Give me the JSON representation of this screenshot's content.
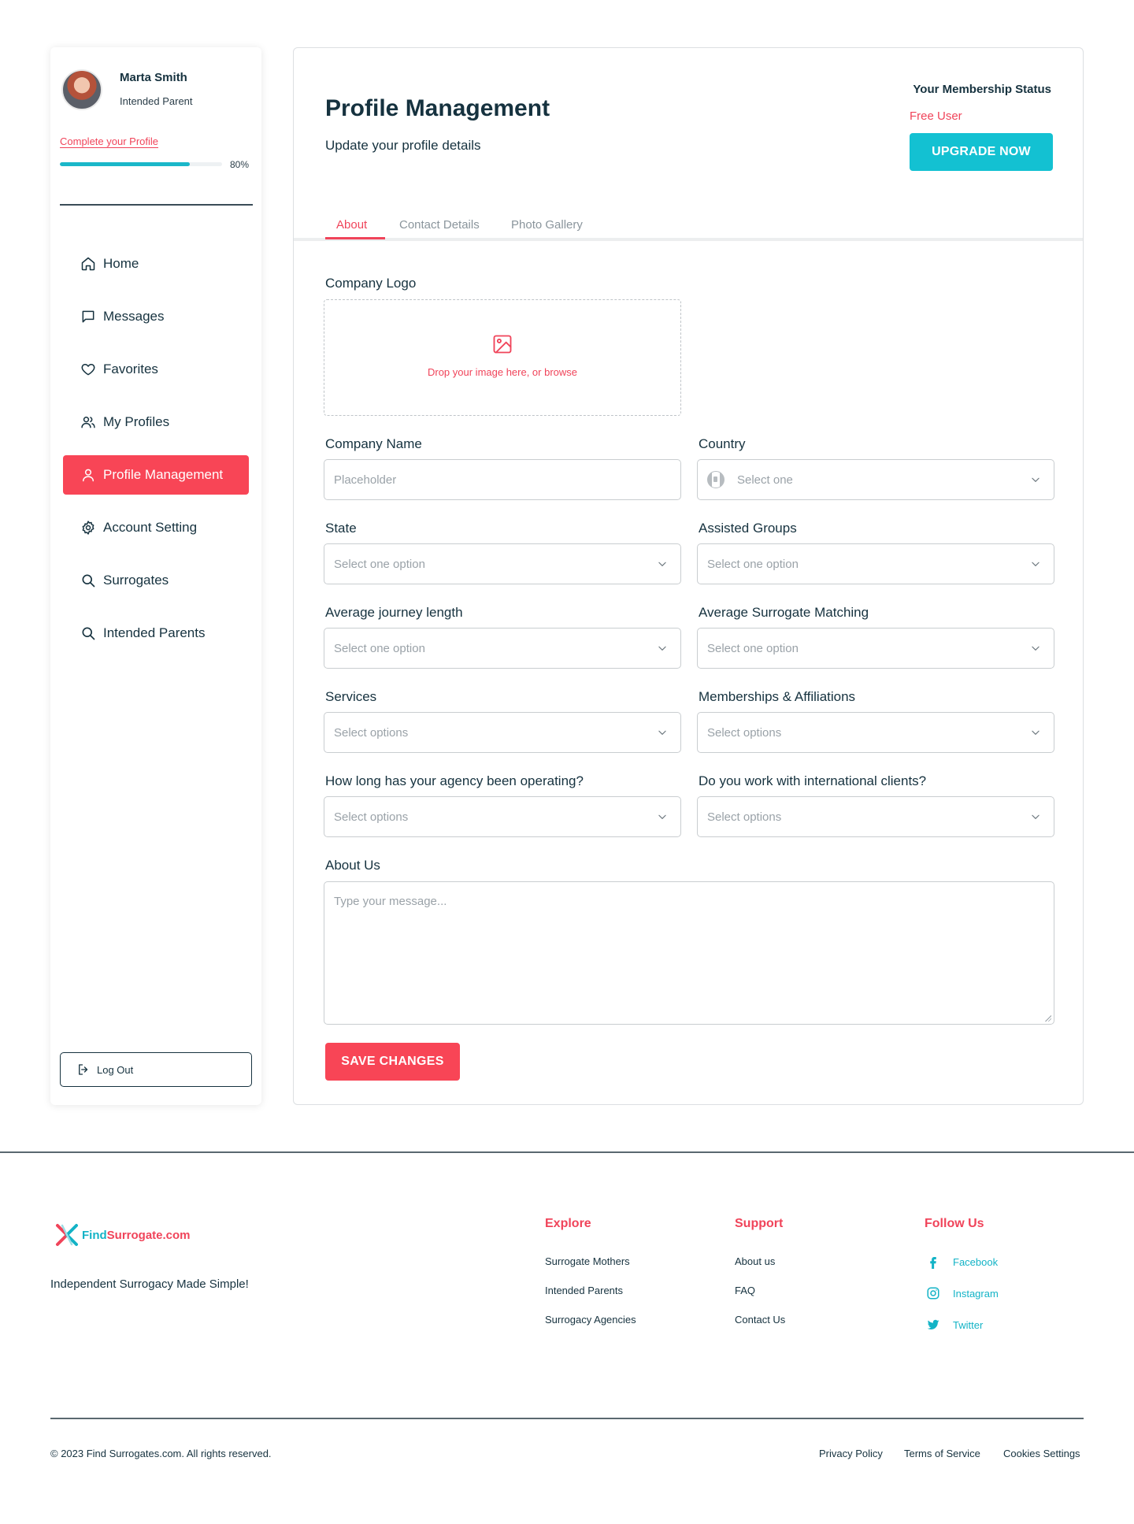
{
  "sidebar": {
    "user_name": "Marta Smith",
    "user_role": "Intended Parent",
    "complete_profile_link": "Complete your Profile",
    "profile_progress": 80,
    "profile_progress_label": "80%",
    "nav": [
      {
        "label": "Home",
        "icon": "home-icon"
      },
      {
        "label": "Messages",
        "icon": "message-icon"
      },
      {
        "label": "Favorites",
        "icon": "heart-icon"
      },
      {
        "label": "My Profiles",
        "icon": "users-icon"
      },
      {
        "label": "Profile Management",
        "icon": "user-icon",
        "active": true
      },
      {
        "label": "Account Setting",
        "icon": "gear-icon"
      },
      {
        "label": "Surrogates",
        "icon": "search-icon"
      },
      {
        "label": "Intended Parents",
        "icon": "search-icon"
      }
    ],
    "logout_label": "Log Out"
  },
  "header": {
    "title": "Profile Management",
    "subtitle": "Update your profile details",
    "membership_label": "Your Membership Status",
    "membership_value": "Free User",
    "upgrade_label": "UPGRADE NOW"
  },
  "tabs": [
    {
      "label": "About",
      "active": true
    },
    {
      "label": "Contact Details",
      "active": false
    },
    {
      "label": "Photo Gallery",
      "active": false
    }
  ],
  "form": {
    "logo_label": "Company Logo",
    "dropzone_text": "Drop your image here, or browse",
    "company_name_label": "Company Name",
    "company_name_placeholder": "Placeholder",
    "country_label": "Country",
    "country_value": "Select one",
    "state_label": "State",
    "state_value": "Select one option",
    "assisted_groups_label": "Assisted Groups",
    "assisted_groups_value": "Select one option",
    "journey_label": "Average journey length",
    "journey_value": "Select one option",
    "matching_label": "Average Surrogate Matching",
    "matching_value": "Select one option",
    "services_label": "Services",
    "services_value": "Select options",
    "memberships_label": "Memberships & Affiliations",
    "memberships_value": "Select options",
    "operating_label": "How long has your agency been operating?",
    "operating_value": "Select options",
    "international_label": "Do you work with international clients?",
    "international_value": "Select options",
    "about_label": "About Us",
    "about_placeholder": "Type your message...",
    "save_label": "SAVE CHANGES"
  },
  "footer": {
    "logo_find": "Find",
    "logo_rest": "Surrogate.com",
    "tagline": "Independent Surrogacy Made Simple!",
    "explore_title": "Explore",
    "explore_links": [
      "Surrogate Mothers",
      "Intended Parents",
      "Surrogacy Agencies"
    ],
    "support_title": "Support",
    "support_links": [
      "About us",
      "FAQ",
      "Contact Us"
    ],
    "follow_title": "Follow Us",
    "social": [
      {
        "label": "Facebook",
        "icon": "facebook-icon"
      },
      {
        "label": "Instagram",
        "icon": "instagram-icon"
      },
      {
        "label": "Twitter",
        "icon": "twitter-icon"
      }
    ],
    "copyright": "© 2023 Find Surrogates.com. All rights reserved.",
    "legal_links": [
      "Privacy Policy",
      "Terms of Service",
      "Cookies Settings"
    ]
  },
  "colors": {
    "accent_red": "#f84556",
    "accent_teal": "#13c1d2",
    "text_dark": "#16323f",
    "placeholder_gray": "#9aa2a8"
  }
}
